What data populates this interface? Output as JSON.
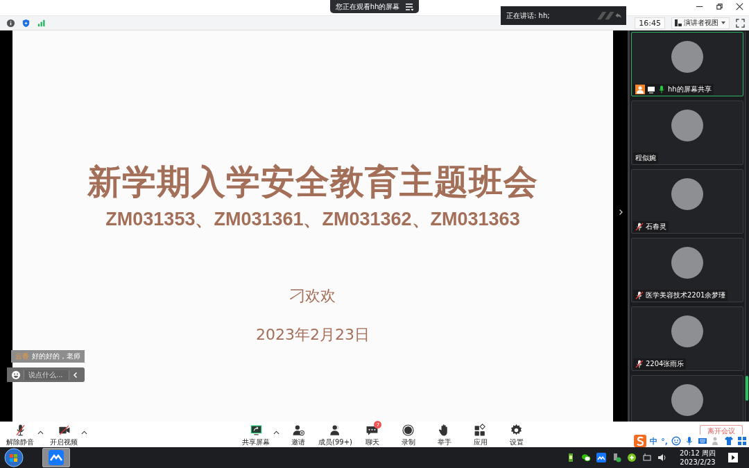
{
  "banner": {
    "title": "您正在观看hh的屏幕"
  },
  "speaking": {
    "text": "正在讲话: hh;"
  },
  "toolbar": {
    "time": "16:45",
    "view": "演讲者视图"
  },
  "slide": {
    "title": "新学期入学安全教育主题班会",
    "subtitle": "ZM031353、ZM031361、ZM031362、ZM031363",
    "author": "刁欢欢",
    "date": "2023年2月23日"
  },
  "chat": {
    "sender": "云香",
    "message": "好的好的，老师",
    "placeholder": "说点什么..."
  },
  "participants": [
    {
      "name": "hh的屏幕共享",
      "muted": false,
      "host": true,
      "selected": true
    },
    {
      "name": "程似婉",
      "host": false,
      "selected": false
    },
    {
      "name": "石春灵",
      "muted": true,
      "host": false,
      "selected": false
    },
    {
      "name": "医学美容技术2201余梦瑾",
      "muted": true,
      "host": false,
      "selected": false
    },
    {
      "name": "2204张雨乐",
      "muted": true,
      "host": false,
      "selected": false
    },
    {
      "host": false,
      "selected": false
    }
  ],
  "controls_left": [
    {
      "kind": "mic-off",
      "label": "解除静音",
      "menu": true
    },
    {
      "kind": "video-off",
      "label": "开启视频",
      "menu": true
    }
  ],
  "controls_center": [
    {
      "kind": "share",
      "label": "共享屏幕",
      "menu": true
    },
    {
      "kind": "invite",
      "label": "邀请",
      "menu": false
    },
    {
      "kind": "members",
      "label": "成员(99+)",
      "menu": false
    },
    {
      "kind": "chat",
      "label": "聊天",
      "menu": false,
      "badge": "7"
    },
    {
      "kind": "record",
      "label": "录制",
      "menu": false
    },
    {
      "kind": "hand",
      "label": "举手",
      "menu": false
    },
    {
      "kind": "apps",
      "label": "应用",
      "menu": false
    },
    {
      "kind": "settings",
      "label": "设置",
      "menu": false
    }
  ],
  "leave_button": "离开会议",
  "ime": {
    "mode": "中",
    "punct": "°,"
  },
  "taskbar": {
    "time": "20:12 周四",
    "date": "2023/2/23"
  }
}
